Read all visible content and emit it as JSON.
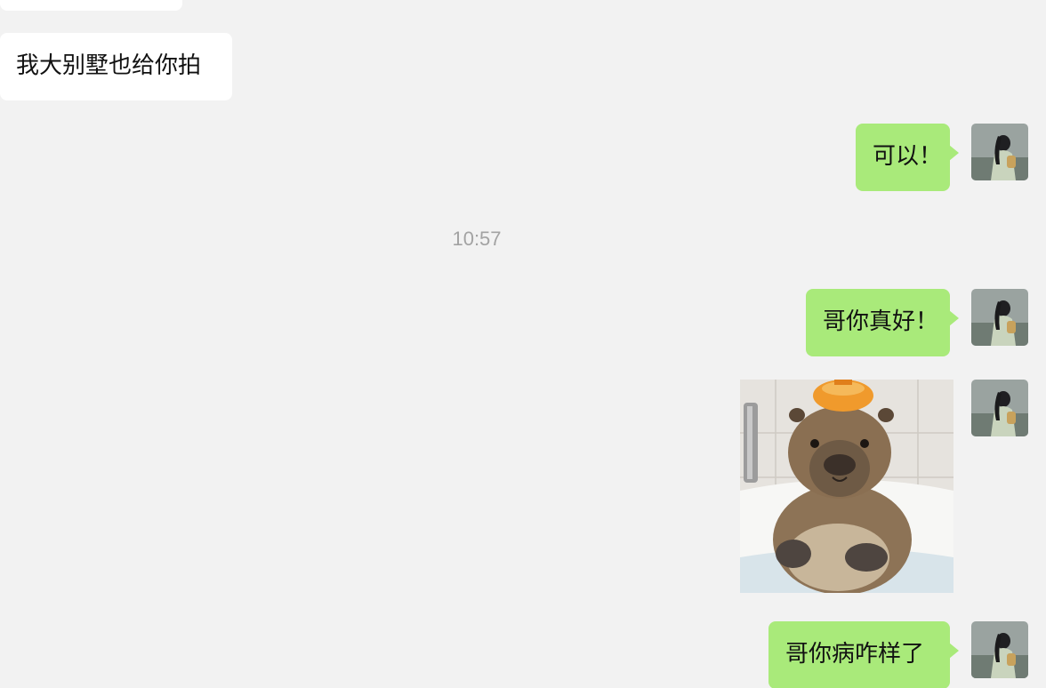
{
  "messages": [
    {
      "side": "in",
      "text": "我大别墅也给你拍"
    },
    {
      "side": "out",
      "text": "可以！"
    },
    {
      "side": "out",
      "text": "哥你真好！"
    },
    {
      "side": "out",
      "type": "image",
      "image_icon": "capybara-photo"
    },
    {
      "side": "out",
      "text": "哥你病咋样了"
    }
  ],
  "timestamp": "10:57",
  "colors": {
    "background": "#f2f2f2",
    "incoming_bubble": "#ffffff",
    "outgoing_bubble": "#a9ea7a",
    "timestamp_text": "#a3a3a3"
  },
  "avatar_icon": "user-avatar-icon"
}
